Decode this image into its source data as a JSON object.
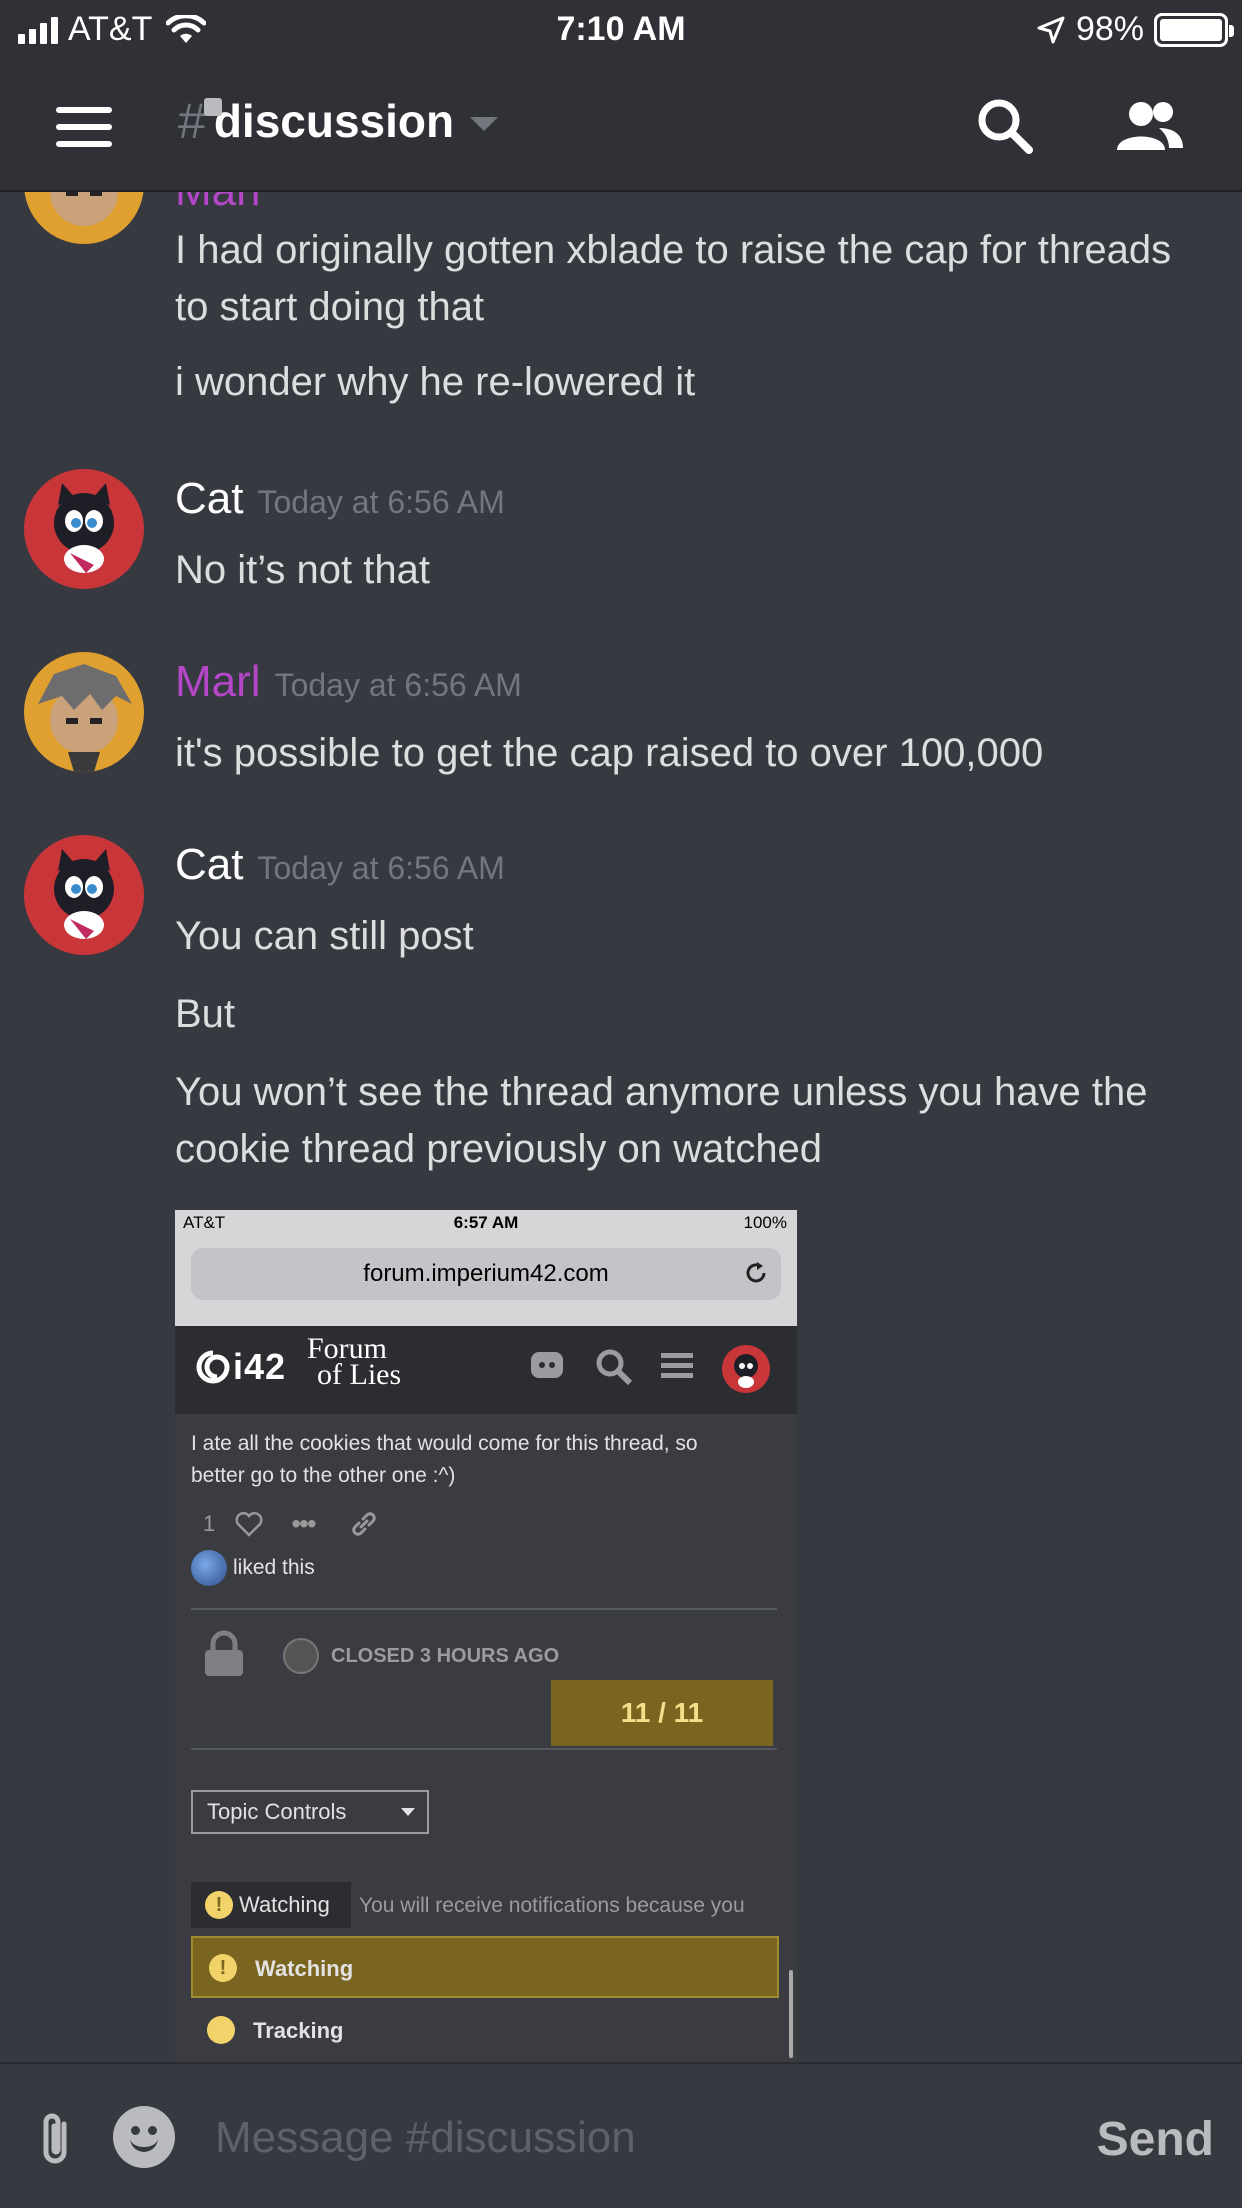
{
  "status_bar": {
    "carrier": "AT&T",
    "time": "7:10 AM",
    "battery": "98%"
  },
  "header": {
    "channel_name": "discussion"
  },
  "messages": [
    {
      "author": "Marl",
      "lines": [
        "I had originally gotten xblade to raise the cap for threads to start doing that",
        "i wonder why he re-lowered it"
      ]
    },
    {
      "author": "Cat",
      "timestamp": "Today at 6:56 AM",
      "lines": [
        "No it’s not that"
      ]
    },
    {
      "author": "Marl",
      "timestamp": "Today at 6:56 AM",
      "lines": [
        "it's possible to get the cap raised to over 100,000"
      ]
    },
    {
      "author": "Cat",
      "timestamp": "Today at 6:56 AM",
      "lines": [
        "You can still post",
        "But",
        "You won’t see the thread anymore unless you have the cookie thread previously on watched"
      ]
    }
  ],
  "attachment": {
    "status_carrier": "AT&T",
    "status_time": "6:57 AM",
    "status_battery": "100%",
    "url": "forum.imperium42.com",
    "logo_i42": "i42",
    "logo_forum": "Forum",
    "logo_of_lies": "of Lies",
    "post_text": "I ate all the cookies that would come for this thread, so better go to the other one :^)",
    "like_count": "1",
    "liked_text": "liked this",
    "closed_text": "CLOSED 3 HOURS AGO",
    "pager": "11 / 11",
    "topic_controls": "Topic Controls",
    "watching_label": "Watching",
    "watching_note": "You will receive notifications because you",
    "options": [
      "Watching",
      "Tracking"
    ]
  },
  "composer": {
    "placeholder": "Message #discussion",
    "send_label": "Send"
  }
}
